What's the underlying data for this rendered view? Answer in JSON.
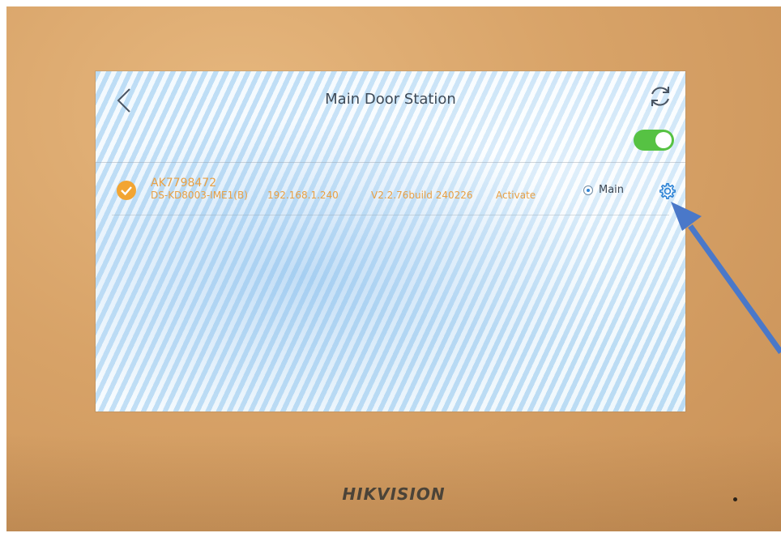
{
  "screen": {
    "title": "Main Door Station",
    "back_icon": "chevron-left-icon",
    "refresh_icon": "refresh-icon",
    "toggle": {
      "state": "on",
      "color": "#56c243"
    }
  },
  "device": {
    "name": "AK7798472",
    "model": "DS-KD8003-IME1(B)",
    "ip": "192.168.1.240",
    "version": "V2.2.76build 240226",
    "status": "Activate",
    "role": "Main",
    "status_icon": "check-circle-icon",
    "settings_icon": "gear-icon"
  },
  "hardware": {
    "brand": "HIKVISION"
  },
  "annotation": {
    "arrow_color": "#4a78c9"
  },
  "colors": {
    "accent_orange": "#e8a044",
    "accent_blue": "#2f84d6",
    "toggle_green": "#56c243"
  }
}
